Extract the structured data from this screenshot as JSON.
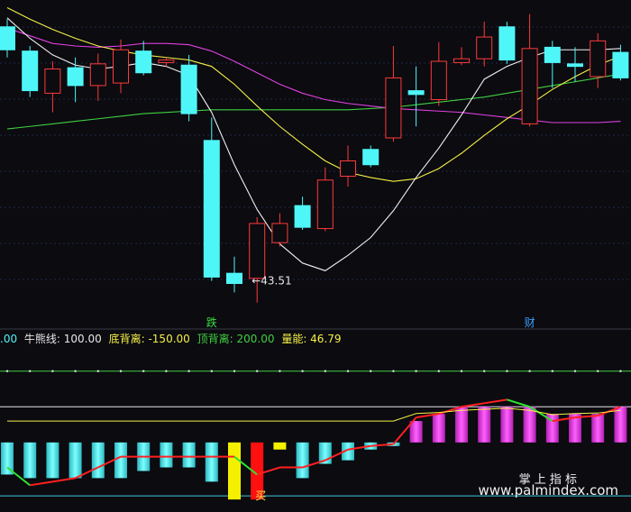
{
  "chart_data": [
    {
      "type": "candlestick",
      "title": "",
      "y_range": [
        41.5,
        65.5
      ],
      "grid": true,
      "colors": {
        "up": "#ff3a3a",
        "down": "#4ff6f8",
        "ma_white": "#f0f0f0",
        "ma_yellow": "#f5f046",
        "ma_magenta": "#e040e0",
        "ma_green": "#40d040"
      },
      "candles": [
        {
          "open": 63.4,
          "close": 61.6,
          "high": 64.0,
          "low": 61.0
        },
        {
          "open": 61.5,
          "close": 58.4,
          "high": 61.9,
          "low": 57.9
        },
        {
          "open": 58.2,
          "close": 60.1,
          "high": 60.7,
          "low": 56.7
        },
        {
          "open": 60.2,
          "close": 58.8,
          "high": 61.0,
          "low": 57.5
        },
        {
          "open": 58.8,
          "close": 60.5,
          "high": 61.3,
          "low": 57.6
        },
        {
          "open": 59.0,
          "close": 61.6,
          "high": 62.4,
          "low": 58.2
        },
        {
          "open": 61.5,
          "close": 59.8,
          "high": 62.3,
          "low": 59.6
        },
        {
          "open": 60.6,
          "close": 60.8,
          "high": 61.0,
          "low": 60.3
        },
        {
          "open": 60.4,
          "close": 56.6,
          "high": 61.2,
          "low": 56.0
        },
        {
          "open": 54.5,
          "close": 43.8,
          "high": 56.3,
          "low": 43.5
        },
        {
          "open": 44.1,
          "close": 43.3,
          "high": 45.4,
          "low": 42.6
        },
        {
          "open": 43.7,
          "close": 48.0,
          "high": 48.5,
          "low": 41.8
        },
        {
          "open": 46.5,
          "close": 48.0,
          "high": 48.8,
          "low": 46.2
        },
        {
          "open": 49.4,
          "close": 47.7,
          "high": 50.1,
          "low": 47.5
        },
        {
          "open": 47.6,
          "close": 51.4,
          "high": 52.4,
          "low": 47.4
        },
        {
          "open": 51.7,
          "close": 52.9,
          "high": 54.1,
          "low": 50.9
        },
        {
          "open": 53.8,
          "close": 52.6,
          "high": 54.1,
          "low": 52.4
        },
        {
          "open": 54.7,
          "close": 59.4,
          "high": 61.9,
          "low": 54.4
        },
        {
          "open": 58.4,
          "close": 58.1,
          "high": 60.3,
          "low": 55.6
        },
        {
          "open": 57.7,
          "close": 60.7,
          "high": 62.2,
          "low": 57.2
        },
        {
          "open": 60.6,
          "close": 60.9,
          "high": 61.8,
          "low": 60.4
        },
        {
          "open": 60.9,
          "close": 62.6,
          "high": 63.8,
          "low": 60.3
        },
        {
          "open": 63.4,
          "close": 60.8,
          "high": 63.8,
          "low": 60.5
        },
        {
          "open": 55.8,
          "close": 61.7,
          "high": 64.4,
          "low": 55.6
        },
        {
          "open": 61.8,
          "close": 60.6,
          "high": 62.3,
          "low": 58.6
        },
        {
          "open": 60.5,
          "close": 60.3,
          "high": 61.8,
          "low": 59.1
        },
        {
          "open": 59.5,
          "close": 62.3,
          "high": 62.9,
          "low": 58.6
        },
        {
          "open": 61.4,
          "close": 59.4,
          "high": 62.0,
          "low": 59.2
        }
      ],
      "ma_white": [
        64.1,
        62.5,
        61.2,
        60.4,
        60.1,
        60.3,
        60.6,
        60.3,
        59.6,
        56.7,
        52.6,
        49.1,
        46.4,
        44.9,
        44.3,
        45.5,
        46.9,
        49.0,
        51.6,
        53.9,
        56.5,
        59.3,
        60.3,
        61.0,
        61.6,
        61.6,
        61.6,
        61.7
      ],
      "ma_yellow": [
        64.9,
        64.0,
        63.2,
        62.5,
        61.9,
        61.5,
        61.2,
        61.0,
        60.8,
        60.3,
        58.9,
        57.2,
        55.6,
        54.2,
        52.9,
        52.0,
        51.6,
        51.3,
        51.5,
        52.3,
        53.5,
        54.9,
        56.2,
        57.3,
        58.5,
        59.5,
        60.4,
        61.1
      ],
      "ma_magenta": [
        63.3,
        62.7,
        62.1,
        61.9,
        61.8,
        61.9,
        62.1,
        62.1,
        62.0,
        61.5,
        60.7,
        59.8,
        58.9,
        58.2,
        57.7,
        57.4,
        57.2,
        57.0,
        56.9,
        56.8,
        56.7,
        56.5,
        56.3,
        56.1,
        55.9,
        55.9,
        55.9,
        56.0
      ],
      "ma_green": [
        55.4,
        55.6,
        55.8,
        56.0,
        56.2,
        56.4,
        56.6,
        56.7,
        56.8,
        56.9,
        56.9,
        56.9,
        56.9,
        56.9,
        56.9,
        56.9,
        57.0,
        57.1,
        57.3,
        57.5,
        57.7,
        57.9,
        58.2,
        58.5,
        58.8,
        59.1,
        59.4,
        59.7
      ],
      "annotations": [
        {
          "text": "跌",
          "candle_index": 9,
          "color": "#3ddc3d"
        },
        {
          "text": "财",
          "candle_index": 23,
          "color": "#3aa0ff"
        },
        {
          "text": "←43.51",
          "value": 43.51,
          "candle_index": 11,
          "color": "#e8e8e8"
        }
      ]
    },
    {
      "type": "bar",
      "title": "",
      "legend": [
        {
          "label": ".00",
          "color": "#4ff6f8"
        },
        {
          "label": "牛熊线: 100.00",
          "color": "#e8e8e8"
        },
        {
          "label": "底背离: -150.00",
          "color": "#f5f046"
        },
        {
          "label": "顶背离: 200.00",
          "color": "#40d040"
        },
        {
          "label": "量能: 46.79",
          "color": "#f5f046"
        }
      ],
      "y_range": [
        -190,
        270
      ],
      "reference_lines": [
        {
          "name": "顶背离",
          "value": 200,
          "color": "#40d040"
        },
        {
          "name": "牛熊线",
          "value": 100,
          "color": "#e8e8e8"
        },
        {
          "name": "底背离",
          "value": -150,
          "color": "#40c8d8"
        }
      ],
      "bars": [
        -90,
        -100,
        -100,
        -100,
        -100,
        -100,
        -80,
        -70,
        -70,
        -110,
        -160,
        -160,
        -20,
        -100,
        -60,
        -50,
        -20,
        -10,
        60,
        80,
        100,
        100,
        100,
        100,
        80,
        80,
        80,
        100
      ],
      "bar_colors": [
        "cyan",
        "cyan",
        "cyan",
        "cyan",
        "cyan",
        "cyan",
        "cyan",
        "cyan",
        "cyan",
        "cyan",
        "yellow",
        "red",
        "yellow",
        "cyan",
        "cyan",
        "cyan",
        "cyan",
        "cyan",
        "magenta",
        "magenta",
        "magenta",
        "magenta",
        "magenta",
        "magenta",
        "magenta",
        "magenta",
        "magenta",
        "magenta"
      ],
      "curve": [
        -70,
        -120,
        -110,
        -100,
        -70,
        -40,
        -40,
        -40,
        -40,
        -40,
        -40,
        -90,
        -70,
        -70,
        -50,
        -20,
        -10,
        -5,
        70,
        80,
        100,
        110,
        120,
        100,
        60,
        70,
        75,
        100
      ],
      "dots": 200,
      "annotations": [
        {
          "text": "买",
          "bar_index": 11,
          "color": "#f5f046"
        }
      ]
    }
  ],
  "watermark": {
    "line1": "掌 上 指 标",
    "line2": "www.palmindex.com"
  }
}
